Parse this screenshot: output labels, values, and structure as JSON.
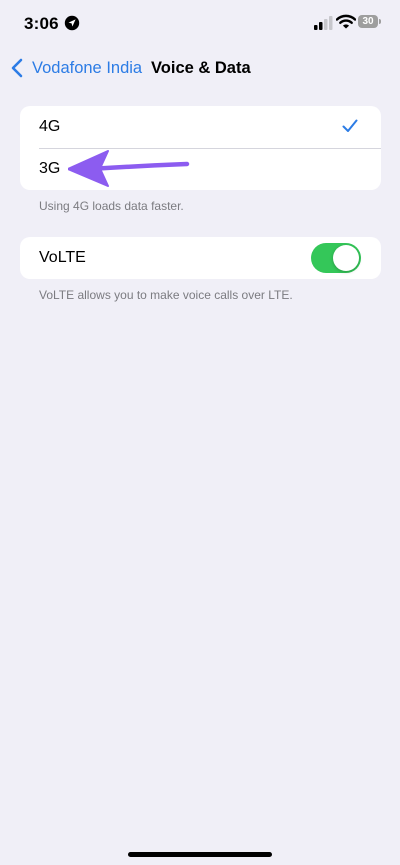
{
  "status_bar": {
    "time": "3:06",
    "battery_level": "30",
    "icons": [
      "location-icon",
      "cellular-signal-icon",
      "wifi-icon",
      "battery-icon"
    ]
  },
  "nav": {
    "back_label": "Vodafone India",
    "title": "Voice & Data"
  },
  "network_options": [
    {
      "label": "4G",
      "selected": true
    },
    {
      "label": "3G",
      "selected": false
    }
  ],
  "network_footnote": "Using 4G loads data faster.",
  "volte": {
    "label": "VoLTE",
    "enabled": true,
    "footnote": "VoLTE allows you to make voice calls over LTE."
  },
  "colors": {
    "accent": "#2c7ce5",
    "toggle_on": "#34c759",
    "annotation_arrow": "#8c5cf0",
    "background": "#f0eff7"
  }
}
